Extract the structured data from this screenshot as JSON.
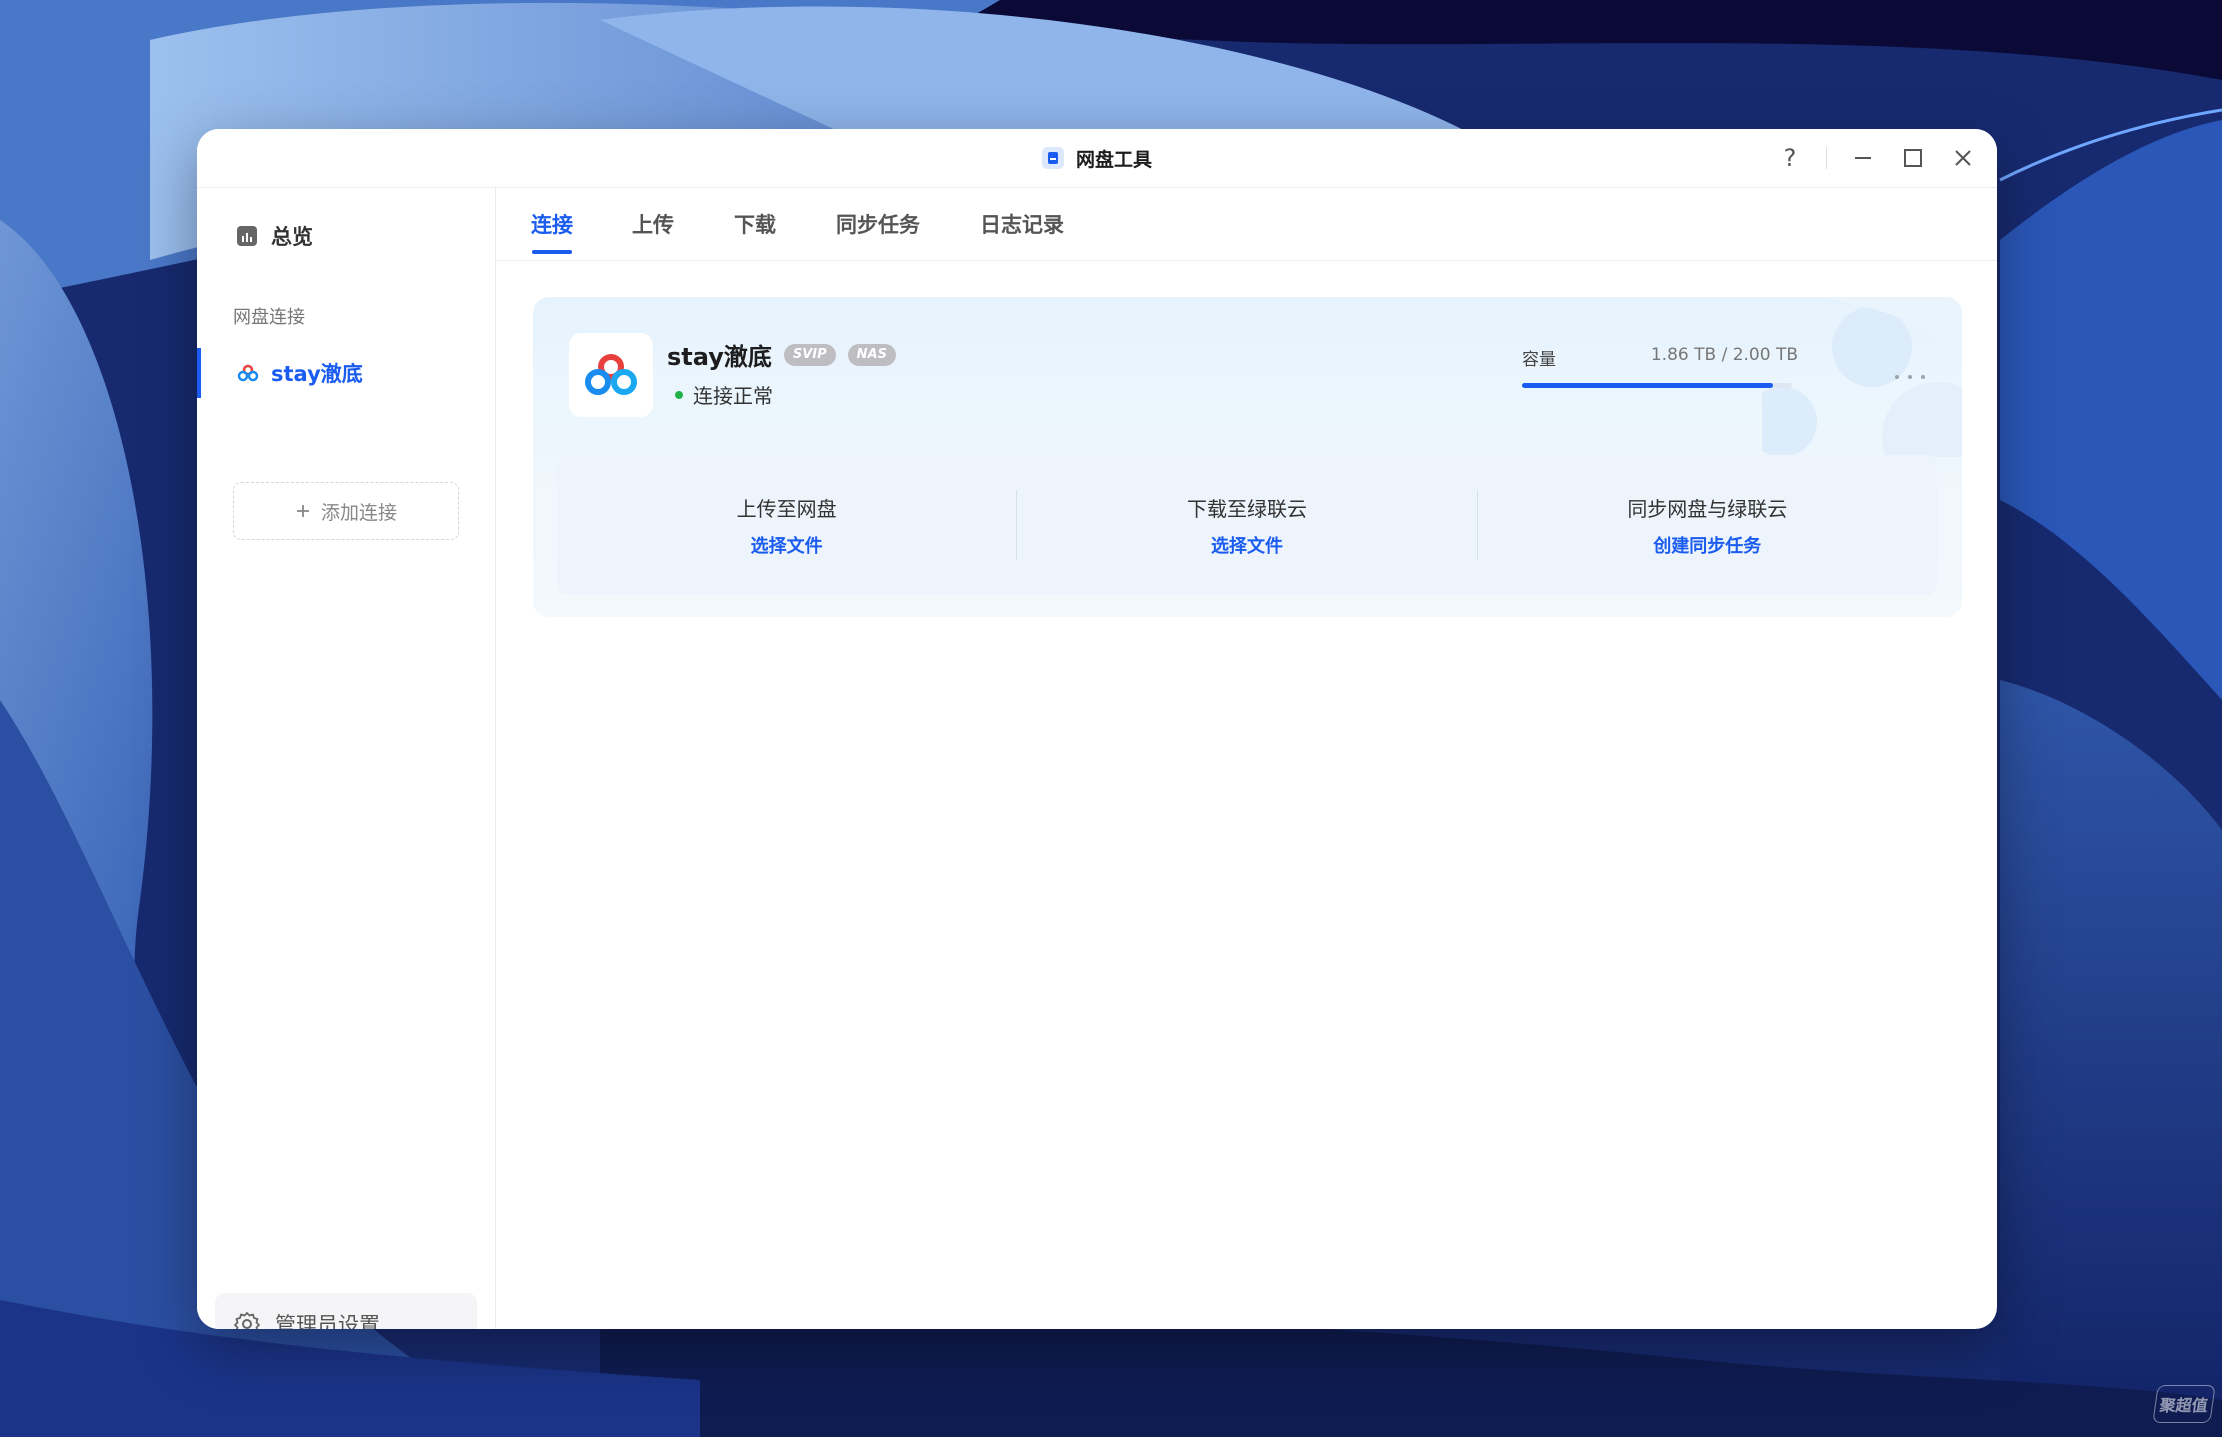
{
  "window": {
    "title": "网盘工具",
    "help_label": "?"
  },
  "sidebar": {
    "overview_label": "总览",
    "section_label": "网盘连接",
    "connection_label": "stay澈底",
    "add_connection_label": "添加连接",
    "admin_settings_label": "管理员设置"
  },
  "tabs": [
    {
      "label": "连接",
      "active": true
    },
    {
      "label": "上传",
      "active": false
    },
    {
      "label": "下载",
      "active": false
    },
    {
      "label": "同步任务",
      "active": false
    },
    {
      "label": "日志记录",
      "active": false
    }
  ],
  "connection": {
    "name": "stay澈底",
    "badges": [
      "SVIP",
      "NAS"
    ],
    "status": "连接正常",
    "capacity_label": "容量",
    "capacity_value": "1.86 TB / 2.00 TB",
    "capacity_used_fraction": 0.93
  },
  "actions": [
    {
      "title": "上传至网盘",
      "link": "选择文件"
    },
    {
      "title": "下载至绿联云",
      "link": "选择文件"
    },
    {
      "title": "同步网盘与绿联云",
      "link": "创建同步任务"
    }
  ],
  "watermark": "聚超值",
  "colors": {
    "accent": "#1a5cf0",
    "status_ok": "#22b24c",
    "badge_gray": "#bdbdc2"
  }
}
